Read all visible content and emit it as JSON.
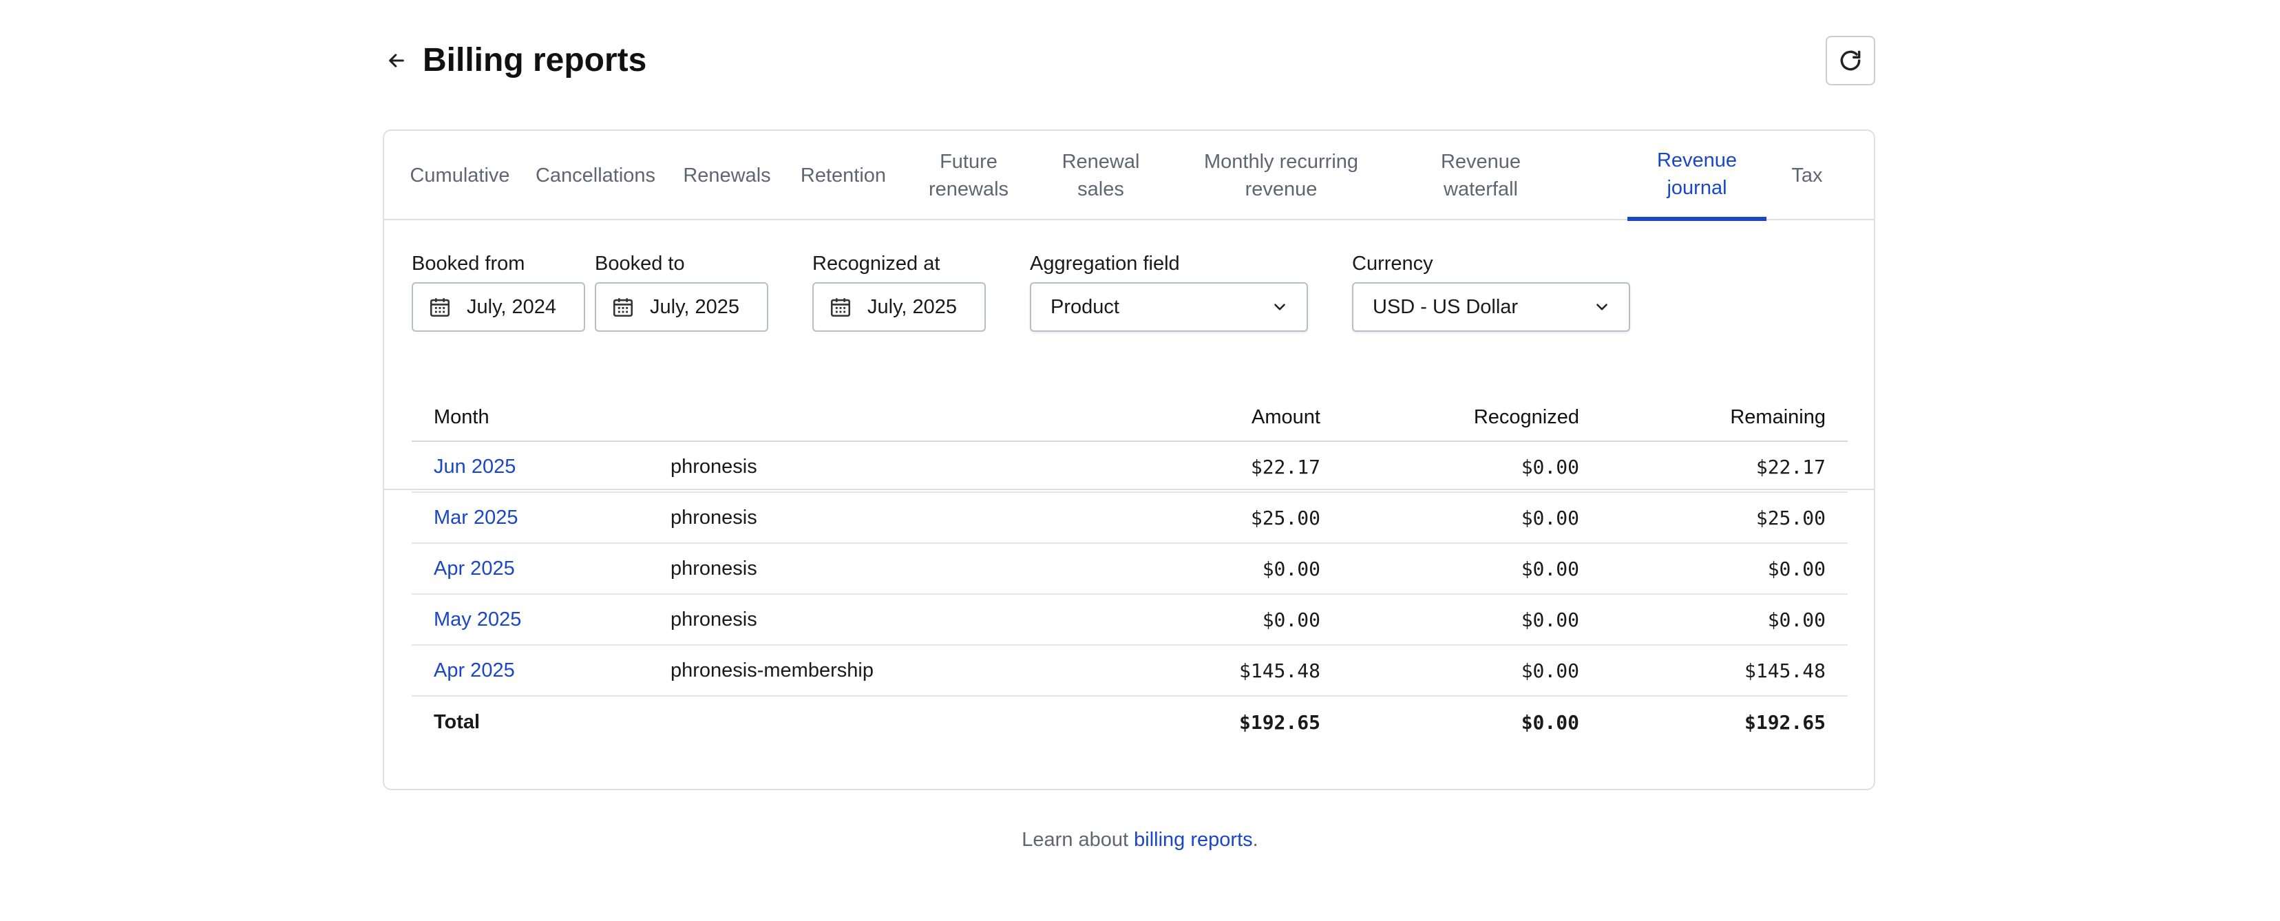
{
  "header": {
    "title": "Billing reports",
    "back_icon": "arrow-left-icon",
    "refresh_icon": "refresh-icon"
  },
  "tabs": [
    {
      "label": "Cumulative",
      "active": false
    },
    {
      "label": "Cancellations",
      "active": false
    },
    {
      "label": "Renewals",
      "active": false
    },
    {
      "label": "Retention",
      "active": false
    },
    {
      "label": "Future\nrenewals",
      "active": false
    },
    {
      "label": "Renewal\nsales",
      "active": false
    },
    {
      "label": "Monthly recurring\nrevenue",
      "active": false
    },
    {
      "label": "Revenue\nwaterfall",
      "active": false
    },
    {
      "label": "Revenue\njournal",
      "active": true
    },
    {
      "label": "Tax",
      "active": false
    }
  ],
  "filters": {
    "booked_from": {
      "label": "Booked from",
      "value": "July, 2024"
    },
    "booked_to": {
      "label": "Booked to",
      "value": "July, 2025"
    },
    "recognized_at": {
      "label": "Recognized at",
      "value": "July, 2025"
    },
    "aggregation": {
      "label": "Aggregation field",
      "value": "Product"
    },
    "currency": {
      "label": "Currency",
      "value": "USD - US Dollar"
    }
  },
  "table": {
    "columns": {
      "month": "Month",
      "product": "",
      "amount": "Amount",
      "recognized": "Recognized",
      "remaining": "Remaining"
    },
    "rows": [
      {
        "month": "Jun 2025",
        "product": "phronesis",
        "amount": "$22.17",
        "recognized": "$0.00",
        "remaining": "$22.17"
      },
      {
        "month": "Mar 2025",
        "product": "phronesis",
        "amount": "$25.00",
        "recognized": "$0.00",
        "remaining": "$25.00"
      },
      {
        "month": "Apr 2025",
        "product": "phronesis",
        "amount": "$0.00",
        "recognized": "$0.00",
        "remaining": "$0.00"
      },
      {
        "month": "May 2025",
        "product": "phronesis",
        "amount": "$0.00",
        "recognized": "$0.00",
        "remaining": "$0.00"
      },
      {
        "month": "Apr 2025",
        "product": "phronesis-membership",
        "amount": "$145.48",
        "recognized": "$0.00",
        "remaining": "$145.48"
      }
    ],
    "total": {
      "label": "Total",
      "amount": "$192.65",
      "recognized": "$0.00",
      "remaining": "$192.65"
    }
  },
  "footer": {
    "prefix": "Learn about ",
    "link": "billing reports",
    "suffix": "."
  },
  "colors": {
    "accent": "#1a46c8",
    "border": "#dcdfe4",
    "muted": "#5f6673"
  }
}
